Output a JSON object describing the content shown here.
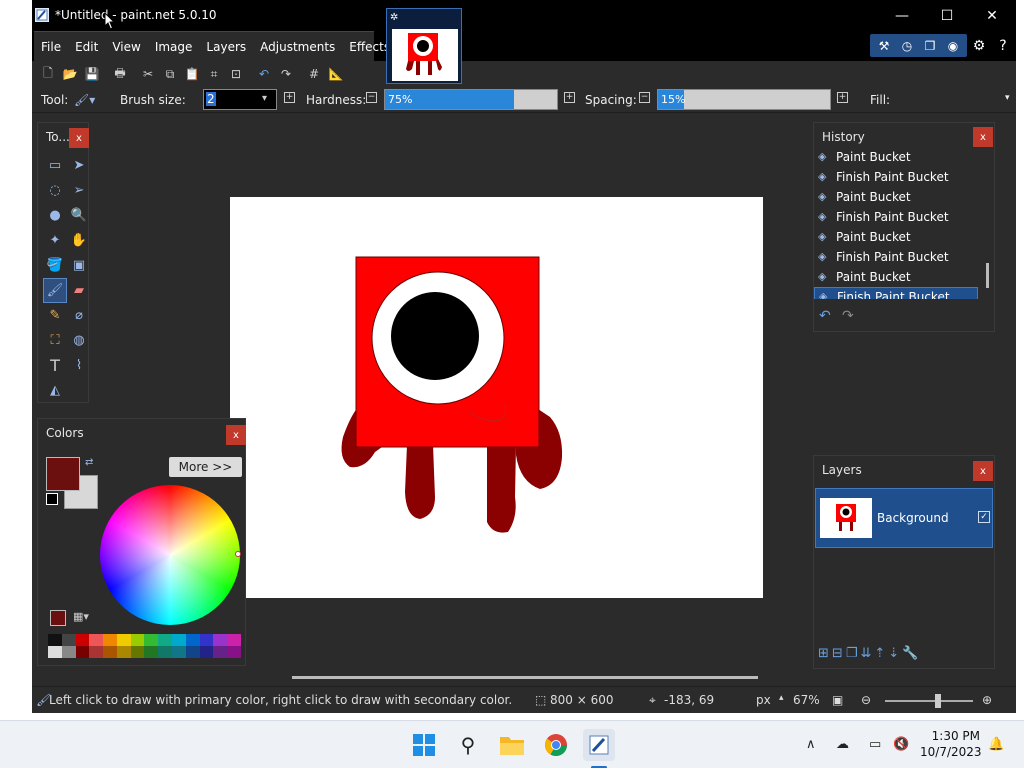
{
  "window": {
    "title": "*Untitled - paint.net 5.0.10",
    "minimize": "—",
    "maximize": "☐",
    "close": "✕"
  },
  "thumbnail": {
    "gear": "✲",
    "close": "⛊"
  },
  "menu": [
    "File",
    "Edit",
    "View",
    "Image",
    "Layers",
    "Adjustments",
    "Effects"
  ],
  "toolbar_options": {
    "tool_label": "Tool:",
    "brush_size_label": "Brush size:",
    "brush_size_value": "2",
    "hardness_label": "Hardness:",
    "hardness_value": "75%",
    "hardness_fraction": 0.75,
    "spacing_label": "Spacing:",
    "spacing_value": "15%",
    "spacing_fraction": 0.15,
    "fill_label": "Fill:"
  },
  "tools_panel": {
    "title": "To...",
    "close": "x"
  },
  "colors_panel": {
    "title": "Colors",
    "close": "x",
    "more_button": "More >>",
    "primary_color": "#6b0f0f",
    "secondary_color": "#d8d8d8"
  },
  "history_panel": {
    "title": "History",
    "close": "x",
    "items": [
      {
        "label": "Paint Bucket",
        "selected": false
      },
      {
        "label": "Finish Paint Bucket",
        "selected": false
      },
      {
        "label": "Paint Bucket",
        "selected": false
      },
      {
        "label": "Finish Paint Bucket",
        "selected": false
      },
      {
        "label": "Paint Bucket",
        "selected": false
      },
      {
        "label": "Finish Paint Bucket",
        "selected": false
      },
      {
        "label": "Paint Bucket",
        "selected": false
      },
      {
        "label": "Finish Paint Bucket",
        "selected": true
      }
    ]
  },
  "layers_panel": {
    "title": "Layers",
    "close": "x",
    "layers": [
      {
        "name": "Background",
        "visible": true
      }
    ]
  },
  "status": {
    "hint": "Left click to draw with primary color, right click to draw with secondary color.",
    "image_size": "800 × 600",
    "cursor_pos": "-183, 69",
    "unit": "px",
    "zoom": "67%"
  },
  "taskbar": {
    "time": "1:30 PM",
    "date": "10/7/2023"
  },
  "colors": {
    "accent": "#2a86d8",
    "red": "#ff0000",
    "dark_red": "#8b0000"
  }
}
